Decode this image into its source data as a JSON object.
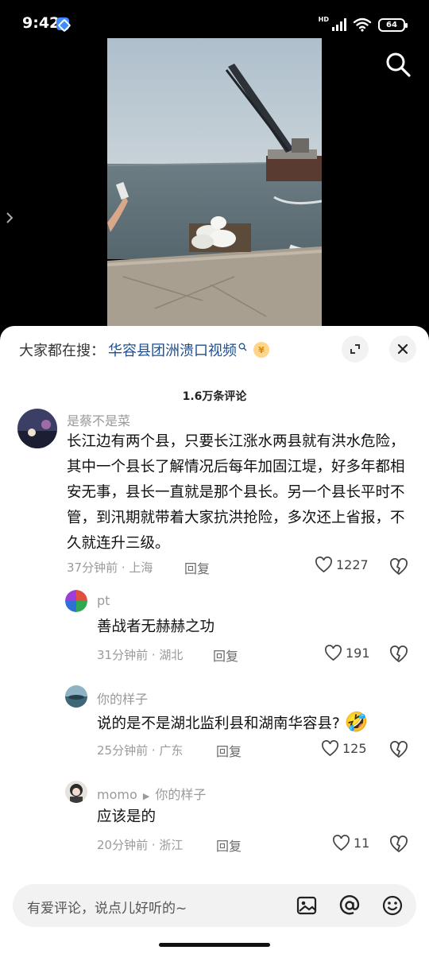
{
  "status_bar": {
    "time": "9:42",
    "network": "HD",
    "battery": "64"
  },
  "video": {
    "search_icon": "search-icon",
    "side_arrow_icon": "chevron-right-icon"
  },
  "hot_search": {
    "prefix": "大家都在搜：",
    "keyword": "华容县团洲溃口视频",
    "coin": "¥"
  },
  "comment_count": "1.6万条评论",
  "comments": [
    {
      "name": "是蔡不是菜",
      "text": "长江边有两个县，只要长江涨水两县就有洪水危险，其中一个县长了解情况后每年加固江堤，好多年都相安无事，县长一直就是那个县长。另一个县长平时不管，到汛期就带着大家抗洪抢险，多次还上省报，不久就连升三级。",
      "meta": "37分钟前 · 上海",
      "reply": "回复",
      "likes": "1227"
    },
    {
      "name": "pt",
      "text": "善战者无赫赫之功",
      "meta": "31分钟前 · 湖北",
      "reply": "回复",
      "likes": "191"
    },
    {
      "name": "你的样子",
      "text": "说的是不是湖北监利县和湖南华容县?",
      "emoji": "🤣",
      "meta": "25分钟前 · 广东",
      "reply": "回复",
      "likes": "125"
    },
    {
      "name": "momo",
      "reply_to": "你的样子",
      "text": "应该是的",
      "meta": "20分钟前 · 浙江",
      "reply": "回复",
      "likes": "11"
    }
  ],
  "input": {
    "placeholder": "有爱评论，说点儿好听的~"
  },
  "colors": {
    "keyword_blue": "#1d4f91",
    "meta_gray": "#9a9a9a",
    "sheet_bg": "#ffffff"
  }
}
